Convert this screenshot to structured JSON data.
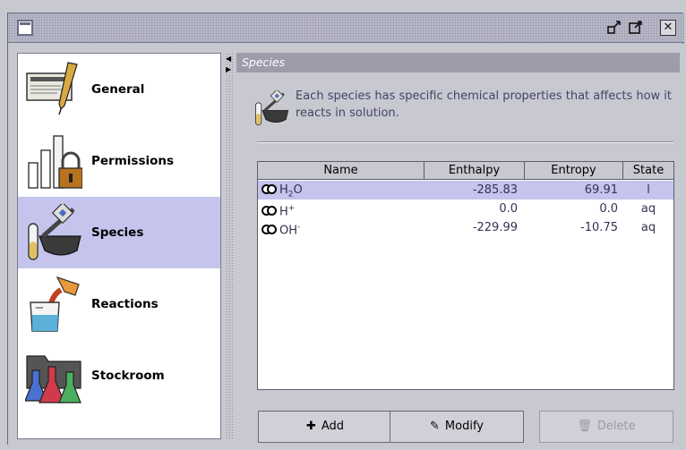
{
  "sidebar": {
    "items": [
      {
        "label": "General",
        "icon": "certificate-pen-icon"
      },
      {
        "label": "Permissions",
        "icon": "bar-chart-lock-icon"
      },
      {
        "label": "Species",
        "icon": "mortar-test-tube-icon",
        "selected": true
      },
      {
        "label": "Reactions",
        "icon": "beaker-pour-icon"
      },
      {
        "label": "Stockroom",
        "icon": "flasks-folder-icon"
      }
    ]
  },
  "panel": {
    "title": "Species",
    "intro": "Each species has specific chemical properties that affects how it reacts in solution."
  },
  "table": {
    "columns": [
      "Name",
      "Enthalpy",
      "Entropy",
      "State"
    ],
    "rows": [
      {
        "name_main": "H",
        "name_sub": "2",
        "name_tail": "O",
        "name_sup": "",
        "enthalpy": "-285.83",
        "entropy": "69.91",
        "state": "l",
        "selected": true
      },
      {
        "name_main": "H",
        "name_sub": "",
        "name_tail": "",
        "name_sup": "+",
        "enthalpy": "0.0",
        "entropy": "0.0",
        "state": "aq",
        "selected": false
      },
      {
        "name_main": "OH",
        "name_sub": "",
        "name_tail": "",
        "name_sup": "-",
        "enthalpy": "-229.99",
        "entropy": "-10.75",
        "state": "aq",
        "selected": false
      }
    ]
  },
  "buttons": {
    "add": "Add",
    "modify": "Modify",
    "delete": "Delete"
  },
  "colors": {
    "selection": "#c4c4ec",
    "panel_title_bg": "#9c9caa",
    "window_bg": "#c8c8d0"
  }
}
